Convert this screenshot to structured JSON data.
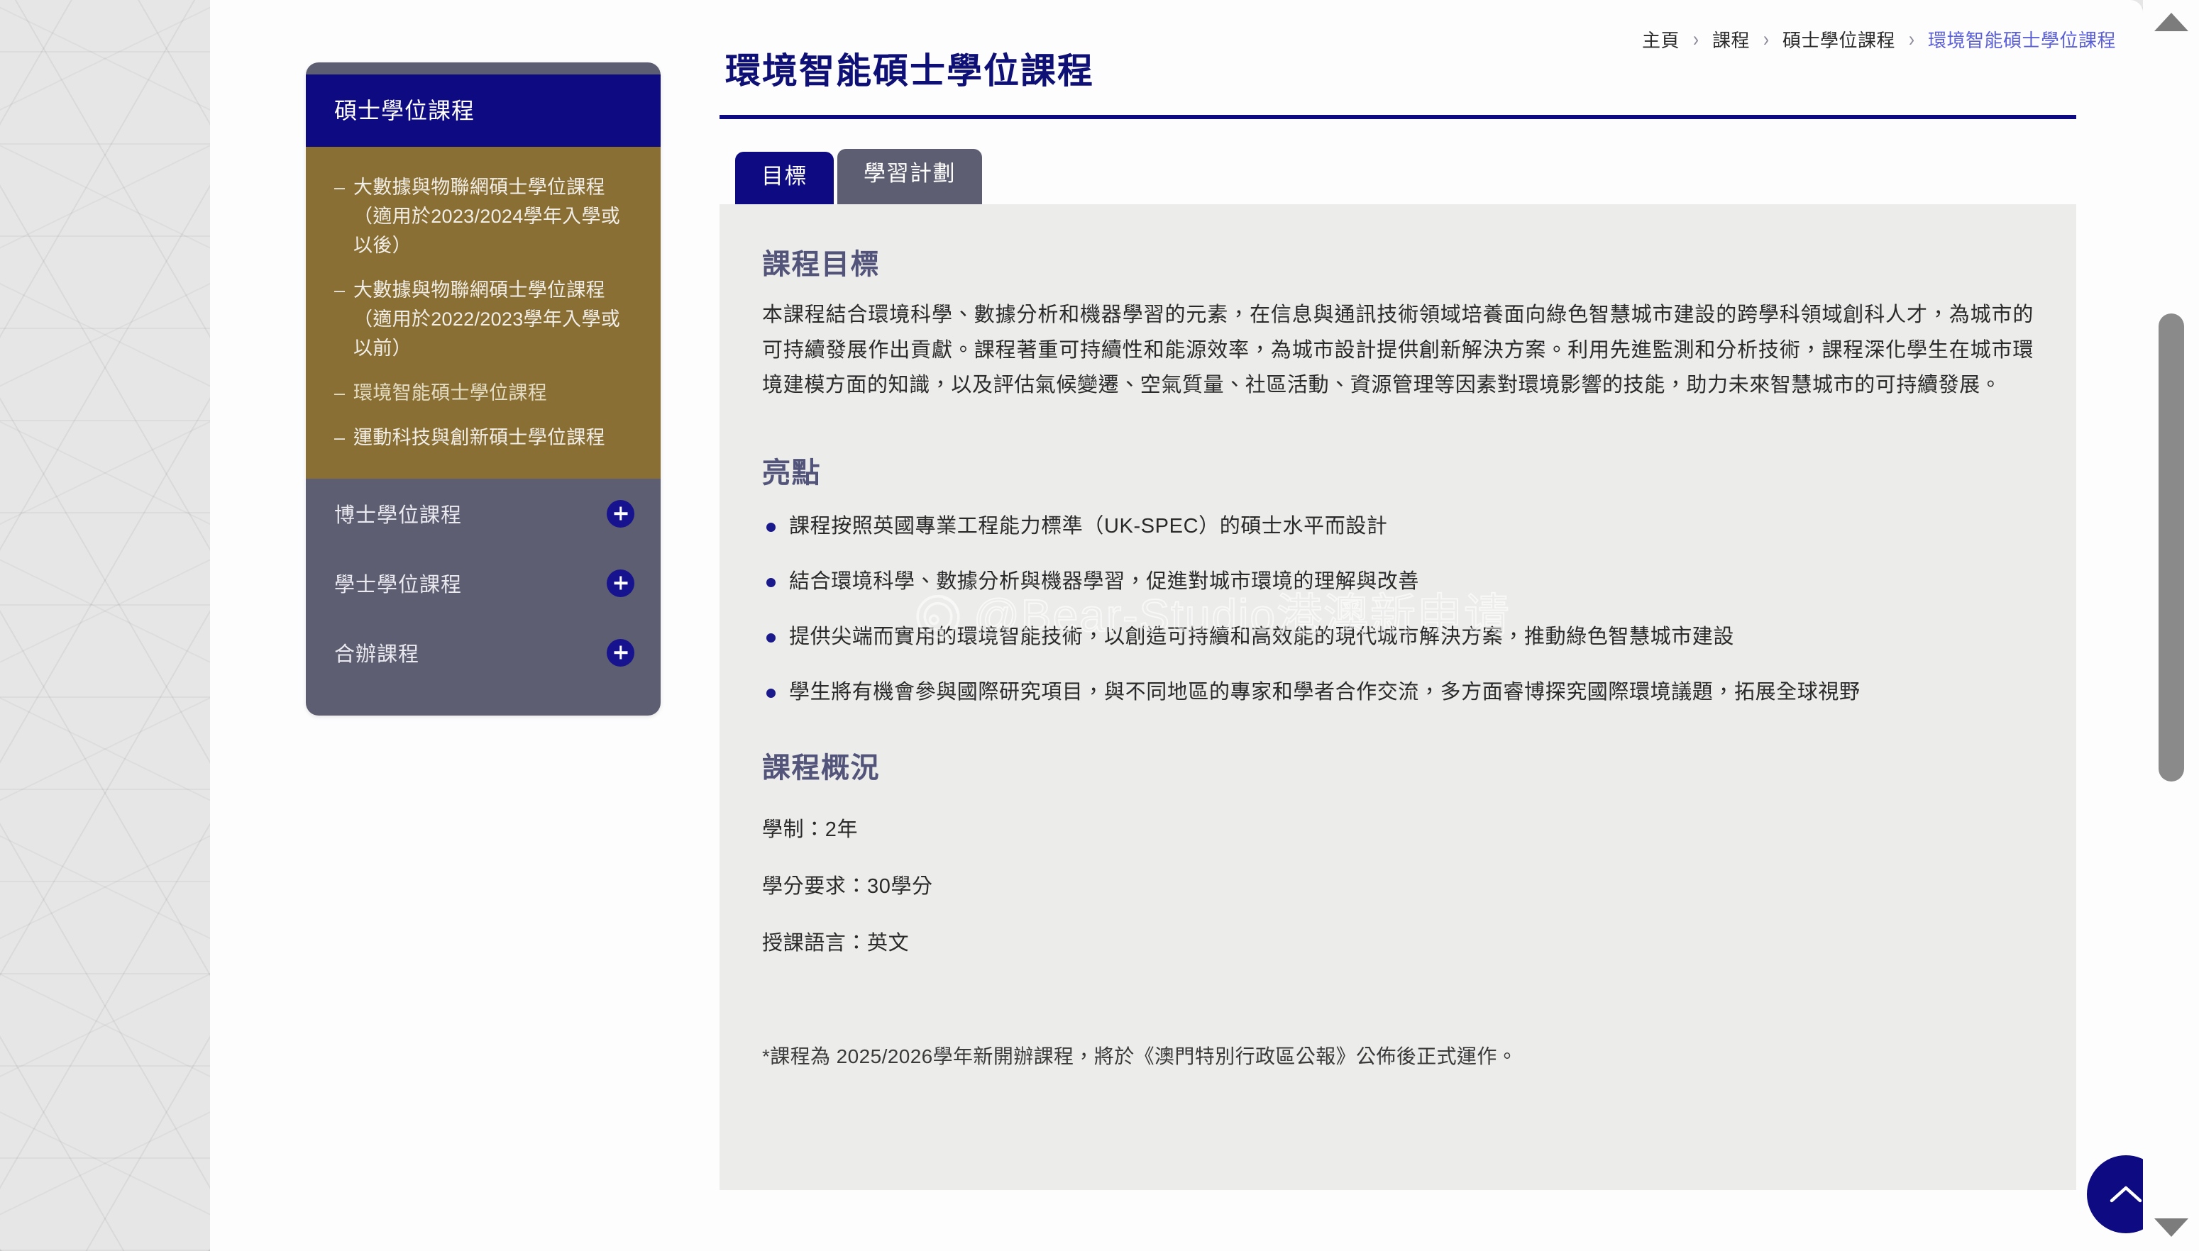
{
  "breadcrumb": {
    "separator": "›",
    "items": [
      {
        "label": "主頁",
        "current": false
      },
      {
        "label": "課程",
        "current": false
      },
      {
        "label": "碩士學位課程",
        "current": false
      },
      {
        "label": "環境智能碩士學位課程",
        "current": true
      }
    ]
  },
  "sidebar": {
    "header_title": "碩士學位課程",
    "dash": "–",
    "sub_items": [
      {
        "label": "大數據與物聯網碩士學位課程（適用於2023/2024學年入學或以後）",
        "active": false
      },
      {
        "label": "大數據與物聯網碩士學位課程（適用於2022/2023學年入學或以前）",
        "active": false
      },
      {
        "label": "環境智能碩士學位課程",
        "active": true
      },
      {
        "label": "運動科技與創新碩士學位課程",
        "active": false
      }
    ],
    "groups": [
      {
        "label": "博士學位課程",
        "expand_icon": "plus-icon"
      },
      {
        "label": "學士學位課程",
        "expand_icon": "plus-icon"
      },
      {
        "label": "合辦課程",
        "expand_icon": "plus-icon"
      }
    ]
  },
  "main": {
    "page_title": "環境智能碩士學位課程",
    "tabs": [
      {
        "label": "目標",
        "active": true
      },
      {
        "label": "學習計劃",
        "active": false
      }
    ],
    "objectives_heading": "課程目標",
    "objectives_body": "本課程結合環境科學、數據分析和機器學習的元素，在信息與通訊技術領域培養面向綠色智慧城市建設的跨學科領域創科人才，為城市的可持續發展作出貢獻。課程著重可持續性和能源效率，為城市設計提供創新解決方案。利用先進監測和分析技術，課程深化學生在城市環境建模方面的知識，以及評估氣候變遷、空氣質量、社區活動、資源管理等因素對環境影響的技能，助力未來智慧城市的可持續發展。",
    "highlights_heading": "亮點",
    "highlights": [
      "課程按照英國專業工程能力標準（UK-SPEC）的碩士水平而設計",
      "結合環境科學、數據分析與機器學習，促進對城市環境的理解與改善",
      "提供尖端而實用的環境智能技術，以創造可持續和高效能的現代城市解決方案，推動綠色智慧城市建設",
      "學生將有機會參與國際研究項目，與不同地區的專家和學者合作交流，多方面睿博探究國際環境議題，拓展全球視野"
    ],
    "overview_heading": "課程概況",
    "facts": [
      "學制：2年",
      "學分要求：30學分",
      "授課語言：英文"
    ],
    "footnote": "*課程為 2025/2026學年新開辦課程，將於《澳門特別行政區公報》公佈後正式運作。"
  },
  "overlays": {
    "watermark_text": "@Bear-Studio港澳新申请",
    "watermark_logo": "weibo-logo-icon",
    "to_top_icon": "chevron-up-icon"
  },
  "scrollbar": {
    "up_icon": "scroll-up-arrow-icon",
    "down_icon": "scroll-down-arrow-icon",
    "thumb": "scrollbar-thumb"
  },
  "colors": {
    "navy": "#0d0a82",
    "brand_blue_text": "#0f1076",
    "breadcrumb_current": "#5b5fd6",
    "sidebar_slate": "#5d5e72",
    "sidebar_gold": "#8a6f34",
    "panel_bg": "#ececeb",
    "heading_slate": "#53547a"
  }
}
